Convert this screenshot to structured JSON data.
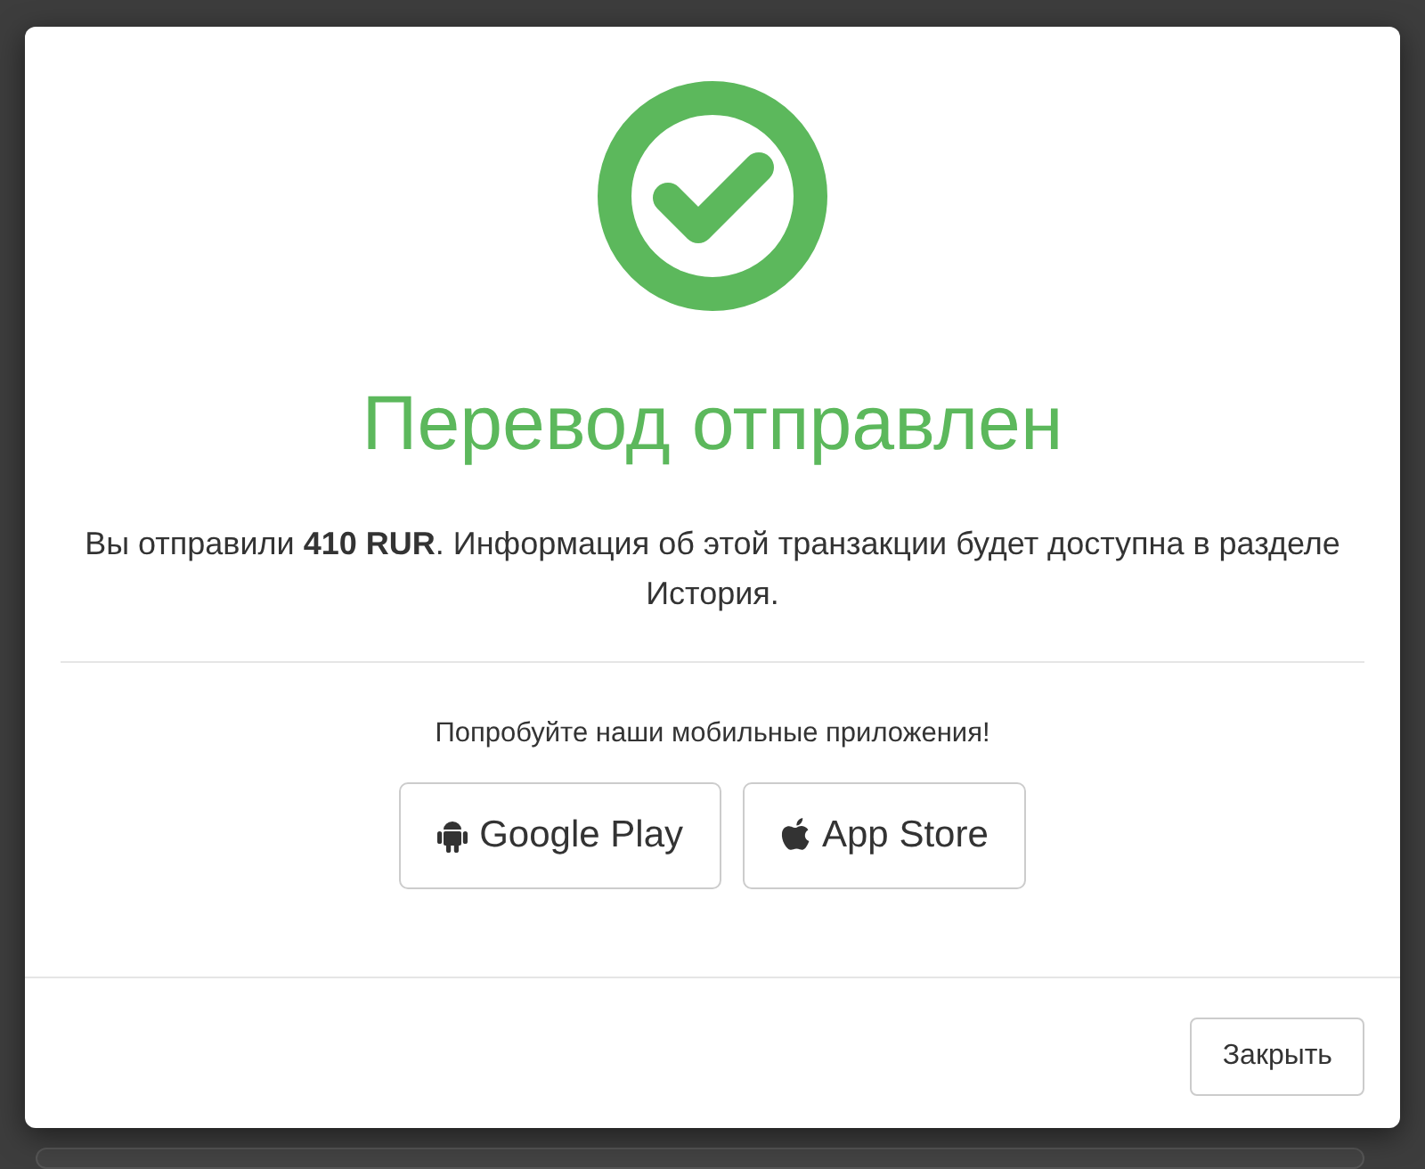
{
  "dialog": {
    "title": "Перевод отправлен",
    "message": "Вы отправили **410 RUR**. Информация об этой транзакции будет доступна в разделе История.",
    "apps_prompt": "Попробуйте наши мобильные приложения!",
    "app_buttons": [
      {
        "kind": "android",
        "label": "Google Play"
      },
      {
        "kind": "apple",
        "label": "App Store"
      }
    ],
    "close_button": "Закрыть"
  }
}
